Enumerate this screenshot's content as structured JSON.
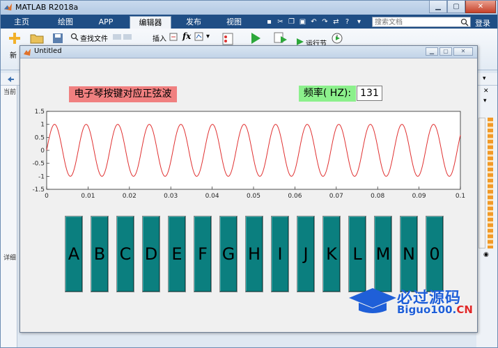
{
  "app": {
    "title": "MATLAB R2018a"
  },
  "tabs": [
    {
      "label": "主页"
    },
    {
      "label": "绘图"
    },
    {
      "label": "APP"
    },
    {
      "label": "编辑器",
      "active": true
    },
    {
      "label": "发布"
    },
    {
      "label": "视图"
    }
  ],
  "search": {
    "placeholder": "搜索文档"
  },
  "login_label": "登录",
  "ribbon": {
    "find_files": "查找文件",
    "insert": "插入",
    "new": "新",
    "run_section": "运行节"
  },
  "left_labels": {
    "current": "当前",
    "detail": "详细"
  },
  "figure": {
    "title": "Untitled",
    "heading": "电子琴按键对应正弦波",
    "freq_label": "频率( HZ):",
    "freq_value": "131",
    "keys": [
      "A",
      "B",
      "C",
      "D",
      "E",
      "F",
      "G",
      "H",
      "I",
      "J",
      "K",
      "L",
      "M",
      "N",
      "0"
    ]
  },
  "chart_data": {
    "type": "line",
    "title": "",
    "xlabel": "",
    "ylabel": "",
    "xlim": [
      0,
      0.1
    ],
    "ylim": [
      -1.5,
      1.5
    ],
    "xticks": [
      "0",
      "0.01",
      "0.02",
      "0.03",
      "0.04",
      "0.05",
      "0.06",
      "0.07",
      "0.08",
      "0.09",
      "0.1"
    ],
    "yticks": [
      "-1.5",
      "-1",
      "-0.5",
      "0",
      "0.5",
      "1",
      "1.5"
    ],
    "grid": false,
    "series": [
      {
        "function": "sin",
        "frequency": 131,
        "amplitude": 1,
        "color": "#e03030"
      }
    ]
  },
  "colors": {
    "key_face": "#0b7f7f",
    "heading_bg": "#f08080",
    "freq_bg": "#8cf08c",
    "tabbar": "#1f4e85"
  },
  "watermark": {
    "title": "必过源码",
    "url_main": "Biguo100.",
    "url_cn": "CN"
  }
}
